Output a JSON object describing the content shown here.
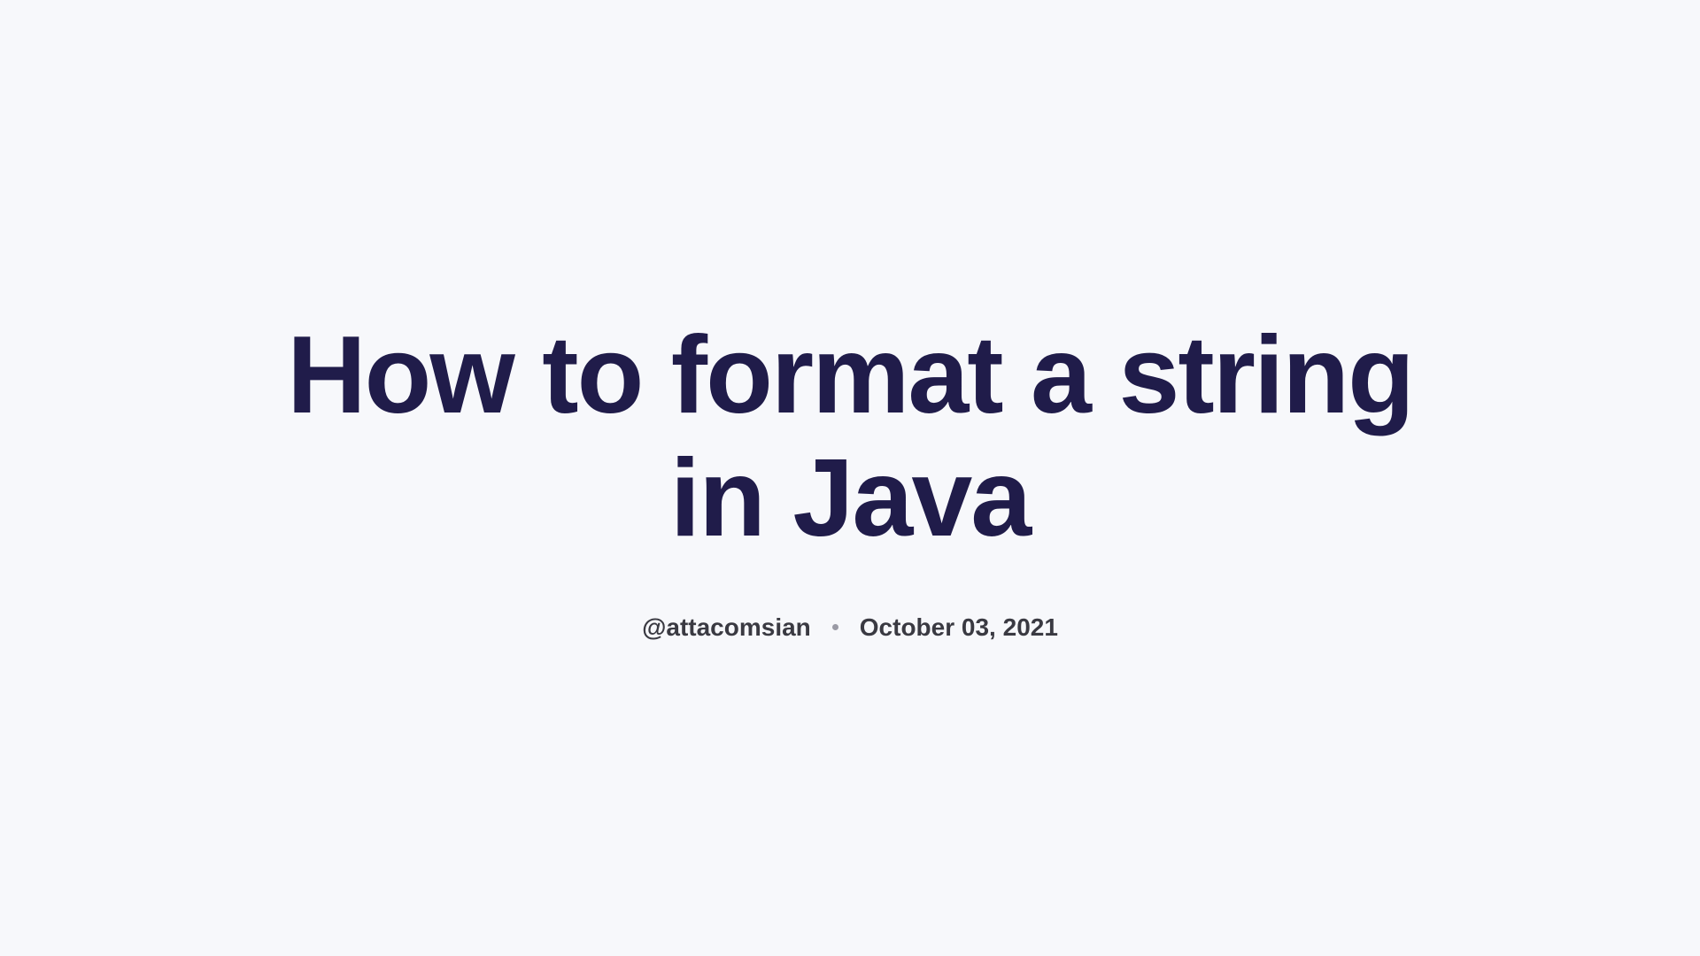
{
  "title": "How to format a string in Java",
  "author": "@attacomsian",
  "date": "October 03, 2021"
}
